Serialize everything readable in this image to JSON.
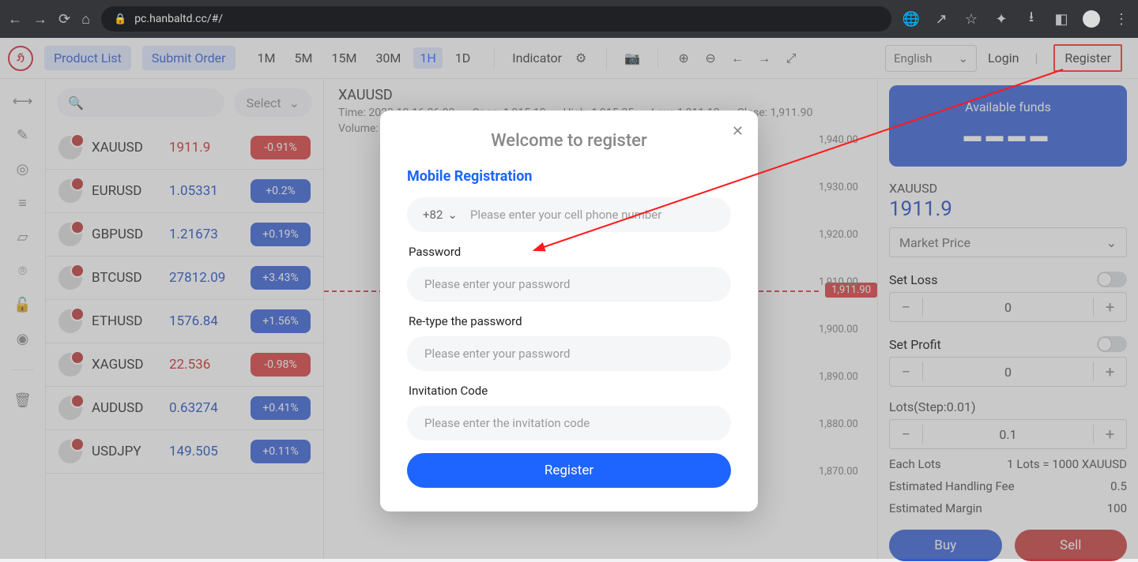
{
  "browser": {
    "url": "pc.hanbaltd.cc/#/",
    "icons": {
      "back": "←",
      "fwd": "→",
      "reload": "⟳",
      "home": "⌂"
    }
  },
  "topbar": {
    "tabs": {
      "product_list": "Product List",
      "submit_order": "Submit Order"
    },
    "tf": [
      "1M",
      "5M",
      "15M",
      "30M",
      "1H",
      "1D"
    ],
    "active_tf": "1H",
    "indicator": "Indicator",
    "lang": "English",
    "login": "Login",
    "register": "Register"
  },
  "search": {
    "select": "Select"
  },
  "watchlist": [
    {
      "sym": "XAUUSD",
      "price": "1911.9",
      "cls": "red",
      "chg": "-0.91%",
      "dir": "down"
    },
    {
      "sym": "EURUSD",
      "price": "1.05331",
      "cls": "blue",
      "chg": "+0.2%",
      "dir": "up"
    },
    {
      "sym": "GBPUSD",
      "price": "1.21673",
      "cls": "blue",
      "chg": "+0.19%",
      "dir": "up"
    },
    {
      "sym": "BTCUSD",
      "price": "27812.09",
      "cls": "blue",
      "chg": "+3.43%",
      "dir": "up"
    },
    {
      "sym": "ETHUSD",
      "price": "1576.84",
      "cls": "blue",
      "chg": "+1.56%",
      "dir": "up"
    },
    {
      "sym": "XAGUSD",
      "price": "22.536",
      "cls": "red",
      "chg": "-0.98%",
      "dir": "down"
    },
    {
      "sym": "AUDUSD",
      "price": "0.63274",
      "cls": "blue",
      "chg": "+0.41%",
      "dir": "up"
    },
    {
      "sym": "USDJPY",
      "price": "149.505",
      "cls": "blue",
      "chg": "+0.11%",
      "dir": "up"
    }
  ],
  "chart": {
    "symbol": "XAUUSD",
    "meta": {
      "time_lbl": "Time:",
      "time": "2023-10-16 06:00",
      "open_lbl": "Open:",
      "open": "1,915.10",
      "high_lbl": "High:",
      "high": "1,915.35",
      "low_lbl": "Low:",
      "low": "1,911.12",
      "close_lbl": "Close:",
      "close": "1,911.90",
      "vol_lbl": "Volume:"
    },
    "yticks": [
      "1,940.00",
      "1,930.00",
      "1,920.00",
      "1,910.00",
      "1,900.00",
      "1,890.00",
      "1,880.00",
      "1,870.00"
    ],
    "current": "1,911.90"
  },
  "panel": {
    "funds_title": "Available funds",
    "funds_value": "▬▬▬▬",
    "symbol": "XAUUSD",
    "price": "1911.9",
    "order_type": "Market Price",
    "set_loss": "Set Loss",
    "loss_val": "0",
    "set_profit": "Set Profit",
    "profit_val": "0",
    "lots_lbl": "Lots(Step:0.01)",
    "lots_val": "0.1",
    "each_lots_l": "Each Lots",
    "each_lots_r": "1 Lots = 1000 XAUUSD",
    "fee_l": "Estimated Handling Fee",
    "fee_r": "0.5",
    "margin_l": "Estimated Margin",
    "margin_r": "100",
    "buy": "Buy",
    "sell": "Sell"
  },
  "modal": {
    "title": "Welcome to register",
    "heading": "Mobile Registration",
    "cc": "+82",
    "phone_ph": "Please enter your cell phone number",
    "pwd_lbl": "Password",
    "pwd_ph": "Please enter your password",
    "pwd2_lbl": "Re-type the password",
    "pwd2_ph": "Please enter your password",
    "code_lbl": "Invitation Code",
    "code_ph": "Please enter the invitation code",
    "submit": "Register"
  }
}
